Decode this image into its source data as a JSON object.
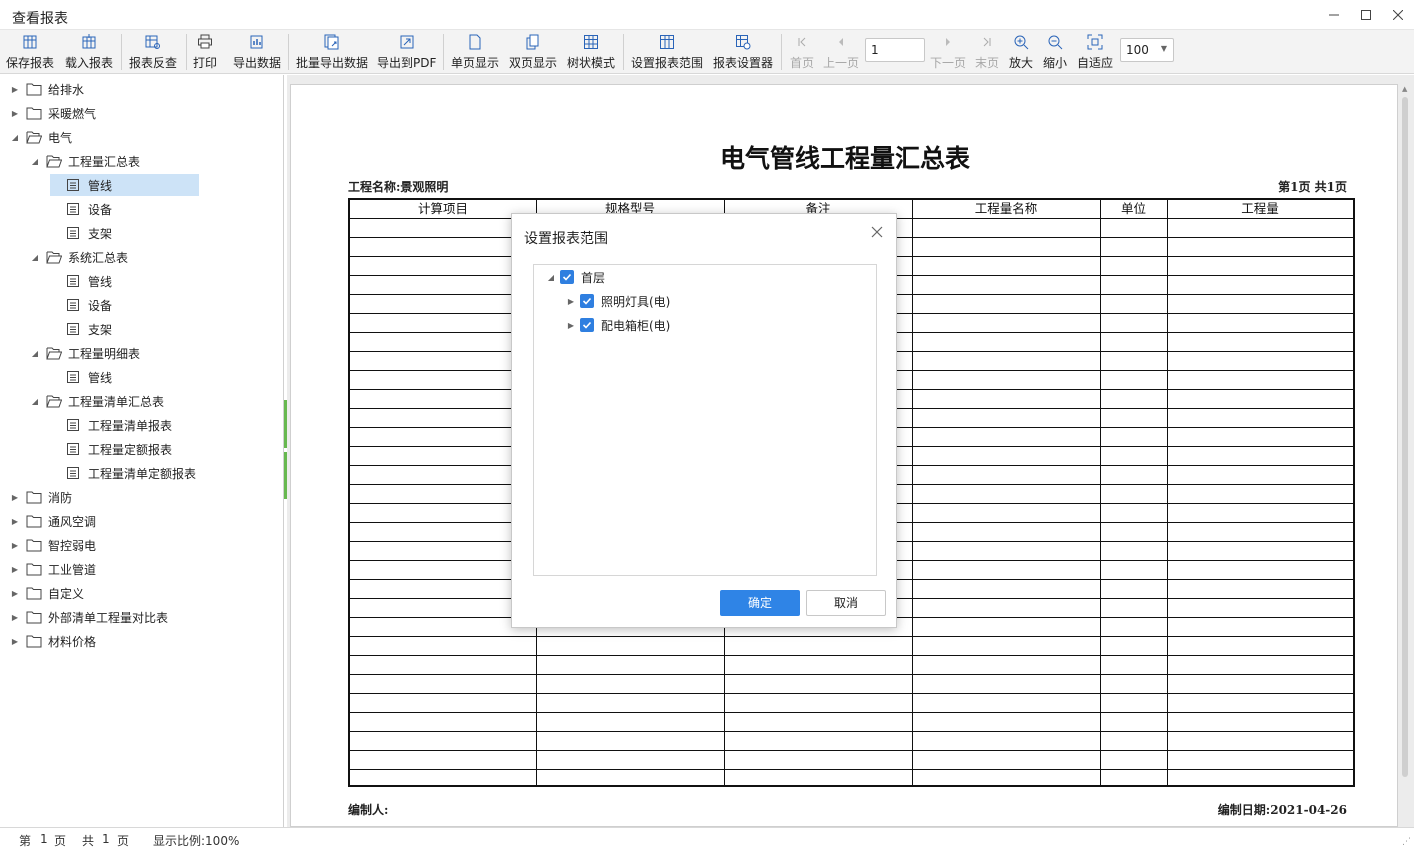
{
  "window": {
    "title": "查看报表"
  },
  "toolbar": {
    "items": [
      {
        "label": "保存报表",
        "icon": "save-report-icon"
      },
      {
        "label": "载入报表",
        "icon": "load-report-icon"
      },
      {
        "label": "报表反查",
        "icon": "reverse-lookup-icon"
      },
      {
        "label": "打印",
        "icon": "printer-icon"
      },
      {
        "label": "导出数据",
        "icon": "export-data-icon"
      },
      {
        "label": "批量导出数据",
        "icon": "batch-export-icon"
      },
      {
        "label": "导出到PDF",
        "icon": "export-pdf-icon"
      },
      {
        "label": "单页显示",
        "icon": "single-page-icon"
      },
      {
        "label": "双页显示",
        "icon": "double-page-icon"
      },
      {
        "label": "树状模式",
        "icon": "tree-mode-icon"
      },
      {
        "label": "设置报表范围",
        "icon": "report-range-icon"
      },
      {
        "label": "报表设置器",
        "icon": "report-settings-icon"
      },
      {
        "label": "首页",
        "icon": "first-page-icon"
      },
      {
        "label": "上一页",
        "icon": "prev-page-icon"
      },
      {
        "label": "下一页",
        "icon": "next-page-icon"
      },
      {
        "label": "末页",
        "icon": "last-page-icon"
      },
      {
        "label": "放大",
        "icon": "zoom-in-icon"
      },
      {
        "label": "缩小",
        "icon": "zoom-out-icon"
      },
      {
        "label": "自适应",
        "icon": "fit-icon"
      }
    ],
    "page_value": "1",
    "zoom_value": "100"
  },
  "sidebar": {
    "items": [
      {
        "label": "给排水",
        "icon": "folder-icon"
      },
      {
        "label": "采暖燃气",
        "icon": "folder-icon"
      },
      {
        "label": "电气",
        "icon": "folder-open-icon"
      },
      {
        "label": "工程量汇总表",
        "icon": "folder-open-icon"
      },
      {
        "label": "管线",
        "icon": "report-icon"
      },
      {
        "label": "设备",
        "icon": "report-icon"
      },
      {
        "label": "支架",
        "icon": "report-icon"
      },
      {
        "label": "系统汇总表",
        "icon": "folder-open-icon"
      },
      {
        "label": "管线",
        "icon": "report-icon"
      },
      {
        "label": "设备",
        "icon": "report-icon"
      },
      {
        "label": "支架",
        "icon": "report-icon"
      },
      {
        "label": "工程量明细表",
        "icon": "folder-open-icon"
      },
      {
        "label": "管线",
        "icon": "report-icon"
      },
      {
        "label": "工程量清单汇总表",
        "icon": "folder-open-icon"
      },
      {
        "label": "工程量清单报表",
        "icon": "report-icon"
      },
      {
        "label": "工程量定额报表",
        "icon": "report-icon"
      },
      {
        "label": "工程量清单定额报表",
        "icon": "report-icon"
      },
      {
        "label": "消防",
        "icon": "folder-icon"
      },
      {
        "label": "通风空调",
        "icon": "folder-icon"
      },
      {
        "label": "智控弱电",
        "icon": "folder-icon"
      },
      {
        "label": "工业管道",
        "icon": "folder-icon"
      },
      {
        "label": "自定义",
        "icon": "folder-icon"
      },
      {
        "label": "外部清单工程量对比表",
        "icon": "folder-icon"
      },
      {
        "label": "材料价格",
        "icon": "folder-icon"
      }
    ],
    "selected_index": 4
  },
  "report": {
    "title": "电气管线工程量汇总表",
    "project": "工程名称:景观照明",
    "page_info": "第1页 共1页",
    "columns": [
      "计算项目",
      "规格型号",
      "备注",
      "工程量名称",
      "单位",
      "工程量"
    ],
    "editor": "编制人:",
    "date": "编制日期:2021-04-26"
  },
  "dialog": {
    "title": "设置报表范围",
    "tree": [
      {
        "label": "首层",
        "checked": true
      },
      {
        "label": "照明灯具(电)",
        "checked": true
      },
      {
        "label": "配电箱柜(电)",
        "checked": true
      }
    ],
    "ok_label": "确定",
    "cancel_label": "取消"
  },
  "status": {
    "page_label": "第",
    "page_num": "1",
    "page_unit": "页",
    "total_label": "共",
    "total_num": "1",
    "total_unit": "页",
    "zoom_text": "显示比例:100%"
  },
  "colors": {
    "accent": "#2f84e6",
    "selection": "#cde3f7",
    "splitter": "#67b84f"
  }
}
